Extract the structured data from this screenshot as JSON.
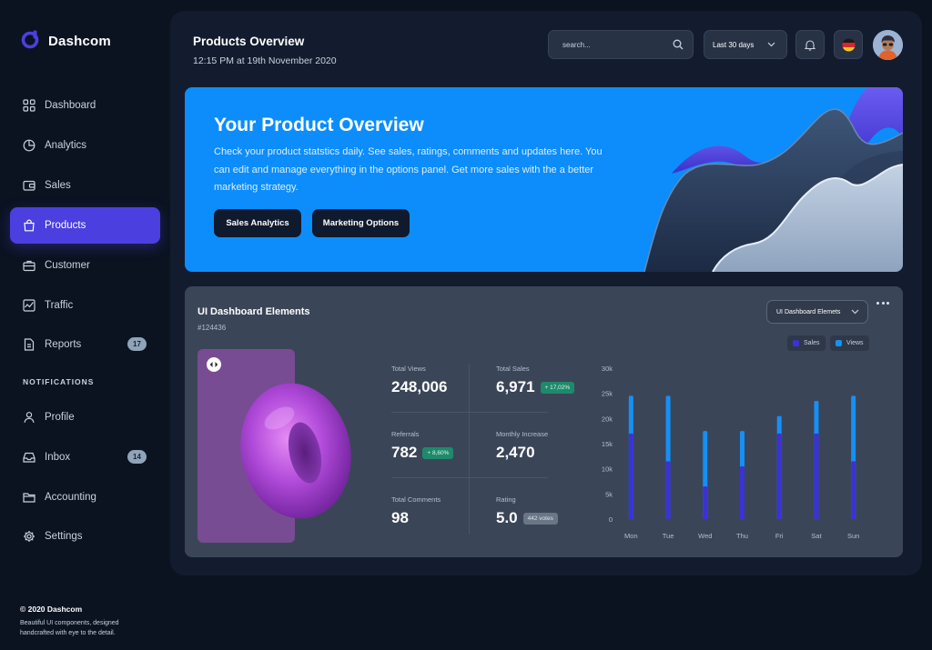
{
  "brand": {
    "name": "Dashcom"
  },
  "sidebar": {
    "items": [
      {
        "label": "Dashboard",
        "icon": "grid-icon"
      },
      {
        "label": "Analytics",
        "icon": "pie-chart-icon"
      },
      {
        "label": "Sales",
        "icon": "wallet-icon"
      },
      {
        "label": "Products",
        "icon": "shopping-bag-icon",
        "active": true
      },
      {
        "label": "Customer",
        "icon": "briefcase-icon"
      },
      {
        "label": "Traffic",
        "icon": "activity-icon"
      },
      {
        "label": "Reports",
        "icon": "document-icon",
        "badge": "17"
      }
    ],
    "section_label": "NOTIFICATIONS",
    "notification_items": [
      {
        "label": "Profile",
        "icon": "user-icon"
      },
      {
        "label": "Inbox",
        "icon": "inbox-icon",
        "badge": "14"
      },
      {
        "label": "Accounting",
        "icon": "folder-icon"
      },
      {
        "label": "Settings",
        "icon": "gear-icon"
      }
    ]
  },
  "footer": {
    "copyright": "© 2020 Dashcom",
    "text": "Beautiful UI components, designed handcrafted with eye to the detail."
  },
  "header": {
    "title": "Products Overview",
    "subtitle": "12:15 PM at 19th November 2020",
    "search_placeholder": "search...",
    "date_range": "Last 30 days"
  },
  "hero": {
    "title": "Your Product Overview",
    "description": "Check your product statstics daily. See sales, ratings, comments and updates here. You can edit and manage everything in the options panel. Get more sales with the a better marketing strategy.",
    "primary_button": "Sales Analytics",
    "secondary_button": "Marketing Options"
  },
  "card": {
    "title": "UI Dashboard Elements",
    "id": "#124436",
    "select_value": "UI Dashboard Elemets",
    "legend": [
      {
        "label": "Sales",
        "color": "#3b32d6"
      },
      {
        "label": "Views",
        "color": "#1590f5"
      }
    ],
    "stats": {
      "total_views": {
        "label": "Total Views",
        "value": "248,006"
      },
      "total_sales": {
        "label": "Total Sales",
        "value": "6,971",
        "badge": "+ 17,02%"
      },
      "referrals": {
        "label": "Referrals",
        "value": "782",
        "badge": "+ 8,60%"
      },
      "monthly_increase": {
        "label": "Monthly Increase",
        "value": "2,470"
      },
      "total_comments": {
        "label": "Total Comments",
        "value": "98"
      },
      "rating": {
        "label": "Rating",
        "value": "5.0",
        "badge": "442 votes"
      }
    }
  },
  "colors": {
    "accent": "#4b3fe0",
    "hero_blue": "#0c8dfb",
    "positive": "#1f8a6b"
  },
  "chart_data": {
    "type": "bar",
    "categories": [
      "Mon",
      "Tue",
      "Wed",
      "Thu",
      "Fri",
      "Sat",
      "Sun"
    ],
    "series": [
      {
        "name": "Sales",
        "values": [
          17000,
          11500,
          6500,
          10500,
          17000,
          17000,
          11500
        ]
      },
      {
        "name": "Views",
        "values": [
          24500,
          24500,
          17500,
          17500,
          20500,
          23500,
          24500
        ]
      }
    ],
    "y_ticks": [
      "0",
      "5k",
      "10k",
      "15k",
      "20k",
      "25k",
      "30k"
    ],
    "ylim": [
      0,
      30000
    ],
    "grid": false,
    "legend_position": "top-right"
  }
}
